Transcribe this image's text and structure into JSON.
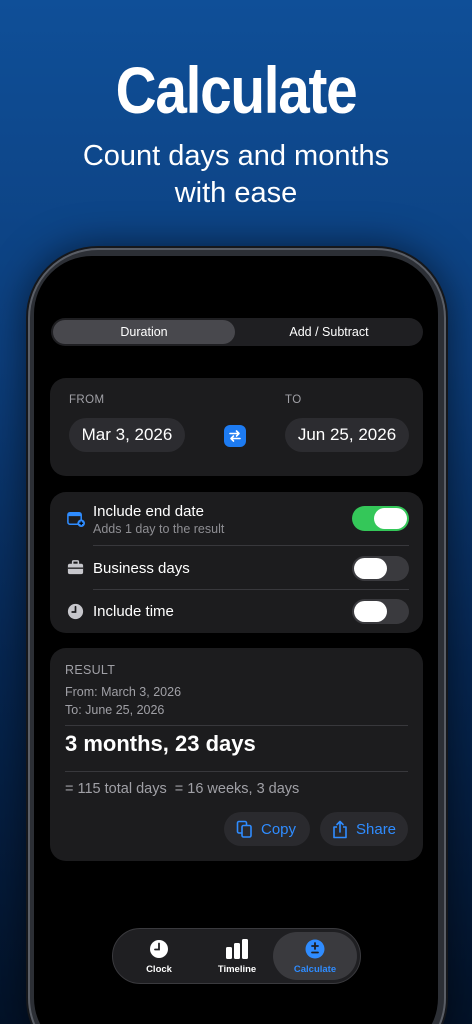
{
  "promo": {
    "title": "Calculate",
    "subtitle_line1": "Count days and months",
    "subtitle_line2": "with ease"
  },
  "segmented": {
    "items": [
      {
        "label": "Duration",
        "selected": true
      },
      {
        "label": "Add / Subtract",
        "selected": false
      }
    ]
  },
  "dates": {
    "from_label": "FROM",
    "from_value": "Mar 3, 2026",
    "to_label": "TO",
    "to_value": "Jun 25, 2026",
    "swap_icon": "swap-arrows-icon"
  },
  "options": [
    {
      "title": "Include end date",
      "subtitle": "Adds 1 day to the result",
      "icon": "calendar-plus-icon",
      "enabled": true
    },
    {
      "title": "Business days",
      "subtitle": "",
      "icon": "briefcase-icon",
      "enabled": false
    },
    {
      "title": "Include time",
      "subtitle": "",
      "icon": "clock-icon",
      "enabled": false
    }
  ],
  "result": {
    "label": "RESULT",
    "from_line": "From: March 3, 2026",
    "to_line": "To: June 25, 2026",
    "main": "3 months, 23 days",
    "summary": "= 115 total days  = 16 weeks, 3 days",
    "copy_label": "Copy",
    "share_label": "Share"
  },
  "tabbar": {
    "items": [
      {
        "label": "Clock",
        "icon": "clock-icon",
        "active": false
      },
      {
        "label": "Timeline",
        "icon": "bar-chart-icon",
        "active": false
      },
      {
        "label": "Calculate",
        "icon": "plus-minus-icon",
        "active": true
      }
    ]
  },
  "colors": {
    "accent": "#2f8cff",
    "toggle_on": "#34c759",
    "background_top": "#0f4f98"
  }
}
